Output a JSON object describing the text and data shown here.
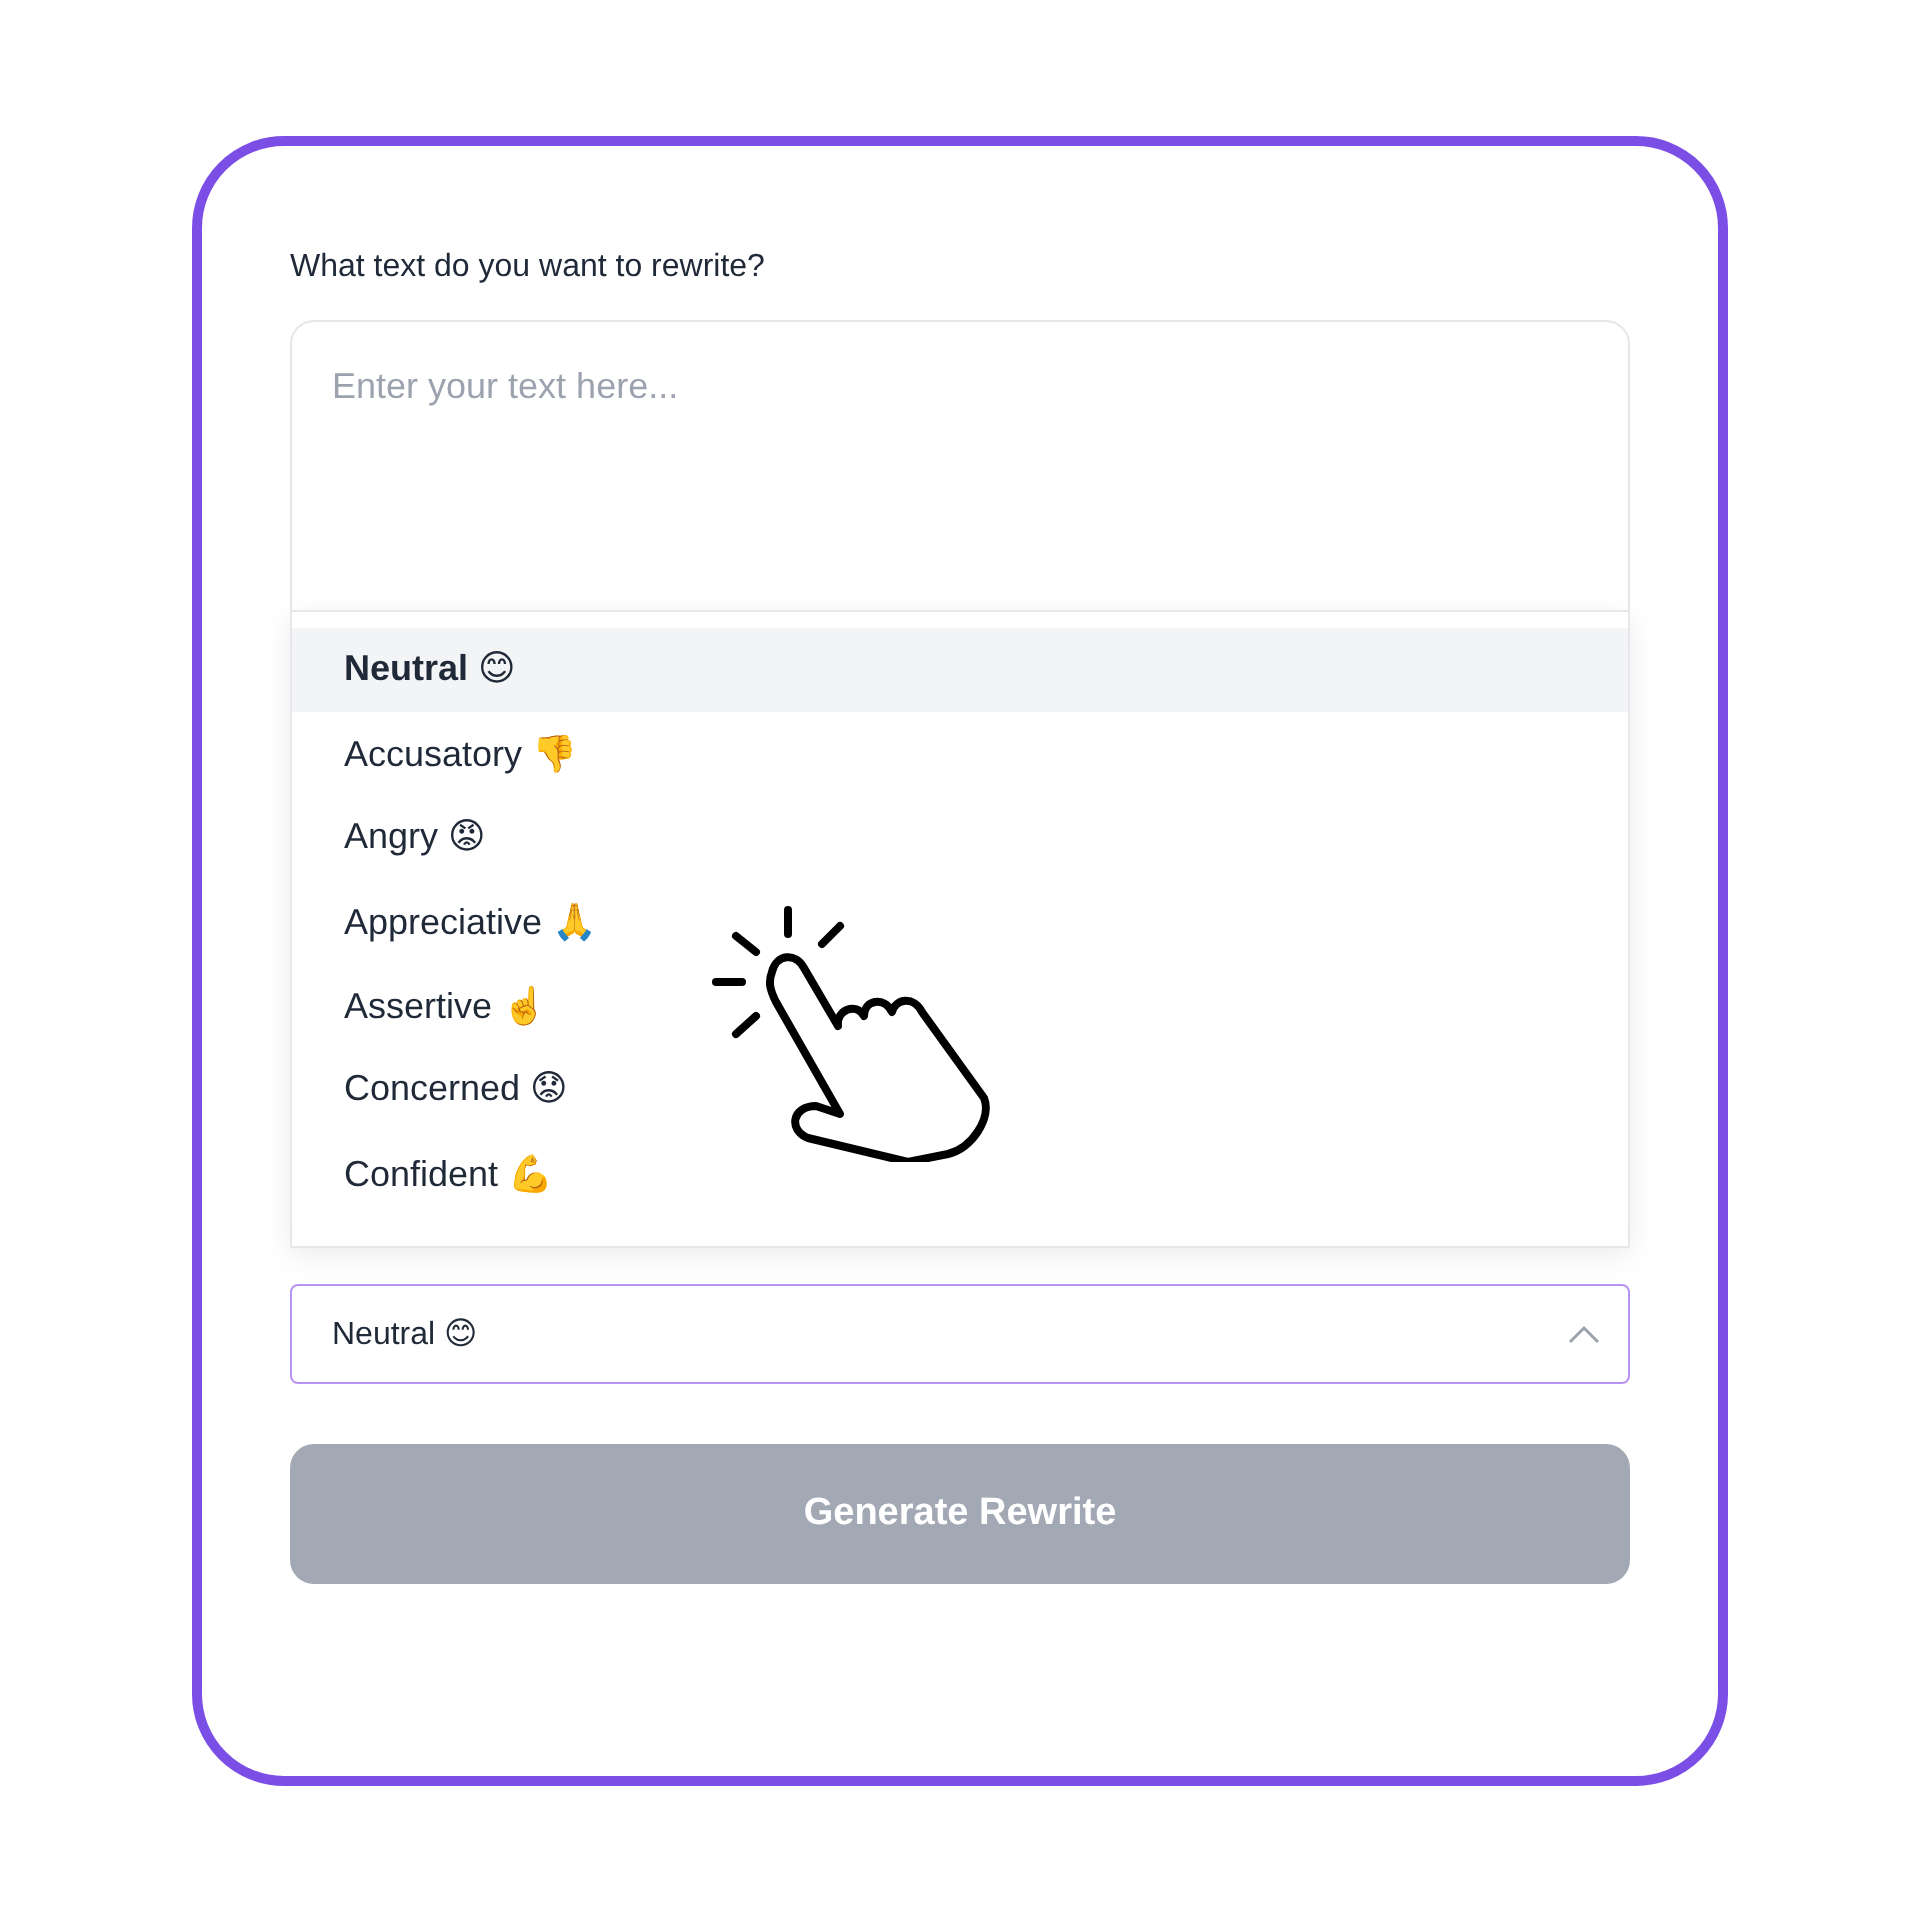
{
  "prompt": {
    "label": "What text do you want to rewrite?"
  },
  "text_input": {
    "placeholder": "Enter your text here..."
  },
  "tone_select": {
    "value": "Neutral 😊",
    "expanded": true,
    "options": [
      {
        "label": "Neutral 😊",
        "selected": true
      },
      {
        "label": "Accusatory 👎",
        "selected": false
      },
      {
        "label": "Angry 😡",
        "selected": false
      },
      {
        "label": "Appreciative 🙏",
        "selected": false
      },
      {
        "label": "Assertive ☝️",
        "selected": false
      },
      {
        "label": "Concerned 😟",
        "selected": false
      },
      {
        "label": "Confident 💪",
        "selected": false
      }
    ]
  },
  "generate_button": {
    "label": "Generate Rewrite",
    "disabled": true
  }
}
